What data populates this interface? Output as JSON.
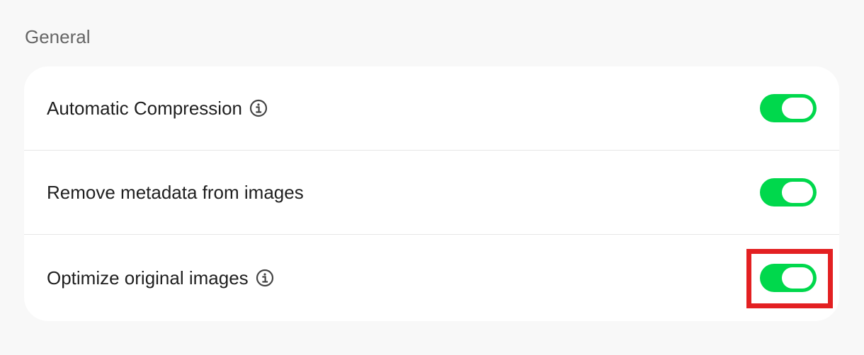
{
  "section": {
    "title": "General"
  },
  "settings": [
    {
      "label": "Automatic Compression",
      "has_info": true,
      "enabled": true
    },
    {
      "label": "Remove metadata from images",
      "has_info": false,
      "enabled": true
    },
    {
      "label": "Optimize original images",
      "has_info": true,
      "enabled": true
    }
  ],
  "icons": {
    "info": "info-circle-icon"
  },
  "colors": {
    "toggle_on": "#00d84c",
    "highlight": "#e32022",
    "background": "#f8f8f8",
    "card": "#ffffff"
  }
}
